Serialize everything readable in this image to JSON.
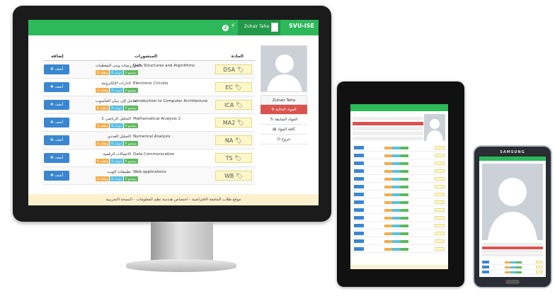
{
  "brand": "SVU-ISE",
  "user": {
    "name": "Zuhair Taha"
  },
  "notifications": {
    "count": "2"
  },
  "table": {
    "col_course": "المادة",
    "col_posts": "المنشورات",
    "col_add": "إضافة"
  },
  "sidebar": {
    "items": [
      {
        "label": "Zuhair Taha"
      },
      {
        "label": "المواد الحالية"
      },
      {
        "label": "المواد السابقة"
      },
      {
        "label": "كافة المواد"
      },
      {
        "label": "خروج"
      }
    ]
  },
  "tags": {
    "tasks": "وظائف",
    "sessions": "دورات",
    "topics": "مواضيع"
  },
  "add_label": "أضف",
  "courses": [
    {
      "code": "DSA",
      "name_en": "Data Structures and Algorithms",
      "name_ar": "الخوارزميات وبنى المعطيات",
      "t1": "0",
      "t2": "0",
      "t3": "0"
    },
    {
      "code": "EC",
      "name_en": "Electronic Circuits",
      "name_ar": "الدارات الإلكترونية",
      "t1": "0",
      "t2": "0",
      "t3": "0"
    },
    {
      "code": "ICA",
      "name_en": "Introduction to Computer Architecture",
      "name_ar": "مدخل إلى بنيان الحاسوب",
      "t1": "0",
      "t2": "0",
      "t3": "0"
    },
    {
      "code": "MA2",
      "name_en": "Mathematical Analysis 2",
      "name_ar": "التحليل الرياضي 2",
      "t1": "0",
      "t2": "0",
      "t3": "0"
    },
    {
      "code": "NA",
      "name_en": "Numerical Analysis",
      "name_ar": "التحليل العددي",
      "t1": "0",
      "t2": "0",
      "t3": "0"
    },
    {
      "code": "TS",
      "name_en": "Data Communication",
      "name_ar": "الاتصالات الرقمية",
      "t1": "0",
      "t2": "0",
      "t3": "0"
    },
    {
      "code": "WB",
      "name_en": "Web applications",
      "name_ar": "تطبيقات الويب",
      "t1": "0",
      "t2": "0",
      "t3": "0"
    }
  ],
  "footer": "موقع طلاب الجامعة الافتراضية - اختصاص هندسة نظم المعلومات - النسخة التجريبية",
  "phone_brand": "SAMSUNG",
  "colors": {
    "topbar": "#2db85a",
    "active": "#d9534f",
    "add_button": "#3a86d0",
    "badge": "#fcf8c9",
    "footer": "#fcf1cf"
  }
}
